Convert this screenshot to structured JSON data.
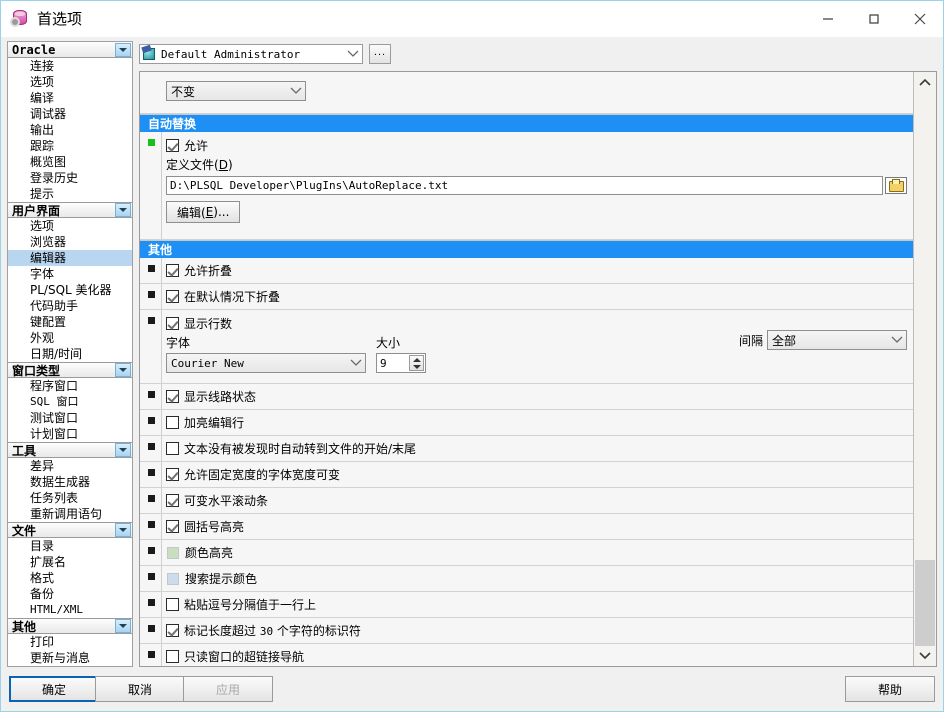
{
  "window": {
    "title": "首选项",
    "icon": "database-gear-icon",
    "minimize": "minimize-icon",
    "maximize": "maximize-icon",
    "close": "close-icon"
  },
  "toolbar": {
    "profile_value": "Default Administrator",
    "profile_icon": "user-globe-icon",
    "more_label": "..."
  },
  "sidebar": {
    "groups": [
      {
        "title": "Oracle",
        "mono": true,
        "items": [
          {
            "label": "连接"
          },
          {
            "label": "选项"
          },
          {
            "label": "编译"
          },
          {
            "label": "调试器"
          },
          {
            "label": "输出"
          },
          {
            "label": "跟踪"
          },
          {
            "label": "概览图"
          },
          {
            "label": "登录历史"
          },
          {
            "label": "提示"
          }
        ]
      },
      {
        "title": "用户界面",
        "mono": false,
        "items": [
          {
            "label": "选项"
          },
          {
            "label": "浏览器"
          },
          {
            "label": "编辑器",
            "selected": true
          },
          {
            "label": "字体"
          },
          {
            "label": "PL/SQL 美化器"
          },
          {
            "label": "代码助手"
          },
          {
            "label": "键配置"
          },
          {
            "label": "外观"
          },
          {
            "label": "日期/时间"
          }
        ]
      },
      {
        "title": "窗口类型",
        "mono": false,
        "items": [
          {
            "label": "程序窗口"
          },
          {
            "label": "SQL 窗口",
            "mono": true
          },
          {
            "label": "测试窗口"
          },
          {
            "label": "计划窗口"
          }
        ]
      },
      {
        "title": "工具",
        "mono": false,
        "items": [
          {
            "label": "差异"
          },
          {
            "label": "数据生成器"
          },
          {
            "label": "任务列表"
          },
          {
            "label": "重新调用语句"
          }
        ]
      },
      {
        "title": "文件",
        "mono": false,
        "items": [
          {
            "label": "目录"
          },
          {
            "label": "扩展名"
          },
          {
            "label": "格式"
          },
          {
            "label": "备份"
          },
          {
            "label": "HTML/XML",
            "mono": true
          }
        ]
      },
      {
        "title": "其他",
        "mono": false,
        "items": [
          {
            "label": "打印"
          },
          {
            "label": "更新与消息"
          }
        ]
      }
    ]
  },
  "content": {
    "top_partial_combo": {
      "value": "不变"
    },
    "sections": [
      {
        "title": "自动替换",
        "rows": [
          {
            "kind": "checkbox-with-file",
            "marker": "green",
            "checkbox_label": "允许",
            "checked": true,
            "file_label_prefix": "定义文件(",
            "file_label_key": "D",
            "file_label_suffix": ")",
            "file_value": "D:\\PLSQL Developer\\PlugIns\\AutoReplace.txt",
            "browse_icon": "folder-open-icon",
            "edit_button_prefix": "编辑(",
            "edit_button_key": "E",
            "edit_button_suffix": ")..."
          }
        ]
      },
      {
        "title": "其他",
        "rows": [
          {
            "kind": "checkbox",
            "checkbox_label": "允许折叠",
            "checked": true
          },
          {
            "kind": "checkbox",
            "checkbox_label": "在默认情况下折叠",
            "checked": true
          },
          {
            "kind": "linenumbers",
            "checkbox_label": "显示行数",
            "checked": true,
            "font_label": "字体",
            "font_value": "Courier New",
            "size_label": "大小",
            "size_value": "9",
            "interval_label": "间隔",
            "interval_value": "全部"
          },
          {
            "kind": "checkbox",
            "checkbox_label": "显示线路状态",
            "checked": true
          },
          {
            "kind": "checkbox",
            "checkbox_label": "加亮编辑行",
            "checked": false
          },
          {
            "kind": "checkbox",
            "checkbox_label": "文本没有被发现时自动转到文件的开始/末尾",
            "checked": false
          },
          {
            "kind": "checkbox",
            "checkbox_label": "允许固定宽度的字体宽度可变",
            "checked": true
          },
          {
            "kind": "checkbox",
            "checkbox_label": "可变水平滚动条",
            "checked": true
          },
          {
            "kind": "checkbox",
            "checkbox_label": "圆括号高亮",
            "checked": true
          },
          {
            "kind": "swatch",
            "checkbox_label": "颜色高亮",
            "color": "#c9dfc2"
          },
          {
            "kind": "swatch",
            "checkbox_label": "搜索提示颜色",
            "color": "#ccdcee"
          },
          {
            "kind": "checkbox",
            "checkbox_label": "粘贴逗号分隔值于一行上",
            "checked": false
          },
          {
            "kind": "checkbox-num",
            "label_before": "标记长度超过",
            "number": "30",
            "label_after": "个字符的标识符",
            "checked": true
          },
          {
            "kind": "checkbox",
            "checkbox_label": "只读窗口的超链接导航",
            "checked": false
          }
        ]
      }
    ]
  },
  "footer": {
    "ok": "确定",
    "cancel": "取消",
    "apply": "应用",
    "help": "帮助"
  },
  "colors": {
    "section_bar": "#1e90f5",
    "selection": "#b8d6ef",
    "accent": "#0a64b4"
  }
}
